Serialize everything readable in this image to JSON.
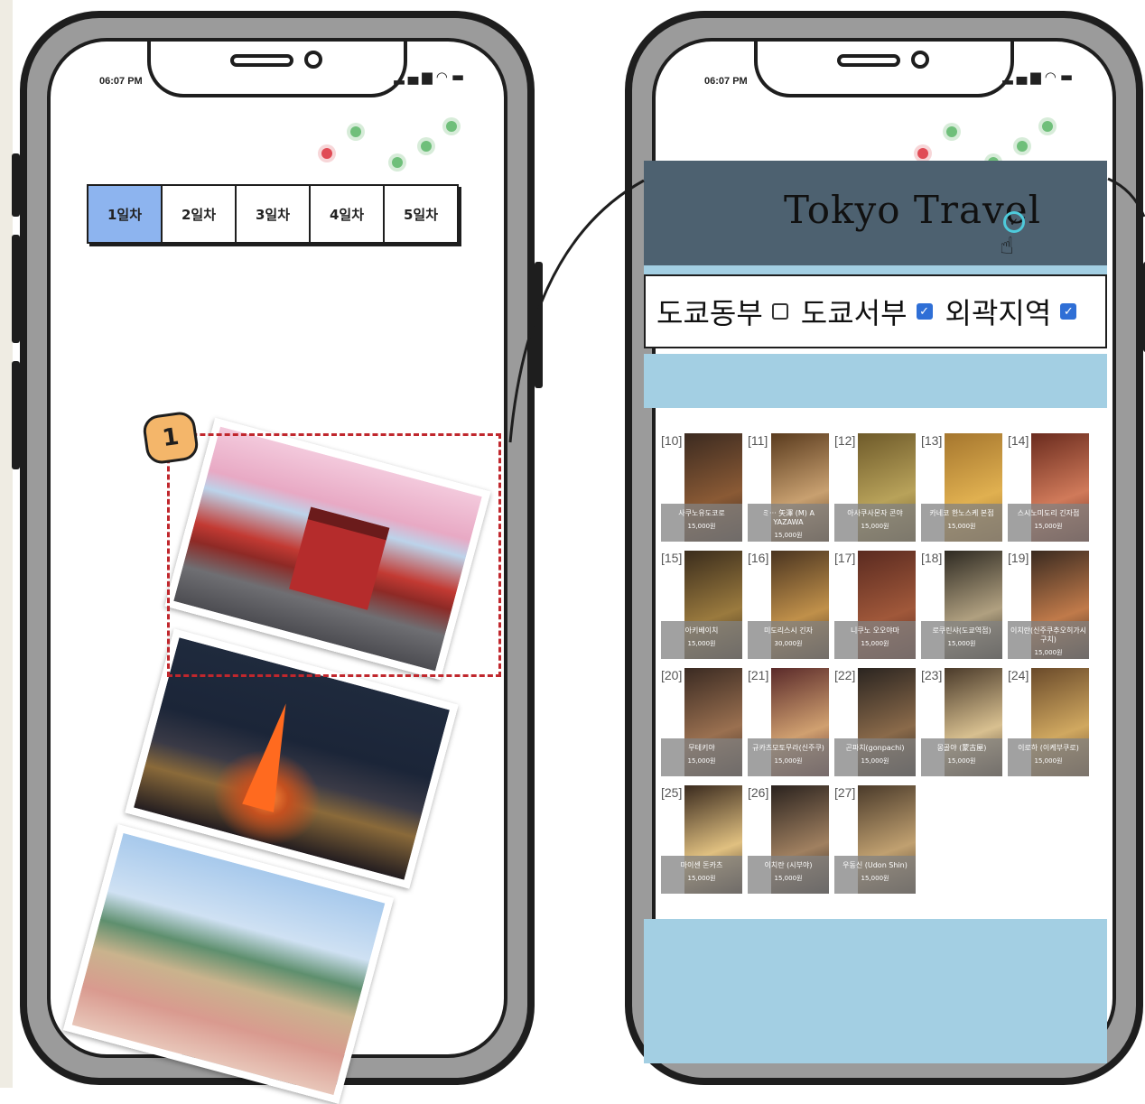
{
  "status_bar": {
    "time": "06:07 PM"
  },
  "left_phone": {
    "day_tabs": [
      {
        "label": "1일차",
        "active": true
      },
      {
        "label": "2일차",
        "active": false
      },
      {
        "label": "3일차",
        "active": false
      },
      {
        "label": "4일차",
        "active": false
      },
      {
        "label": "5일차",
        "active": false
      }
    ],
    "marker_number": "1"
  },
  "right_phone": {
    "app_title": "Tokyo Travel",
    "regions": [
      {
        "label": "도쿄동부",
        "checked": false
      },
      {
        "label": "도쿄서부",
        "checked": true
      },
      {
        "label": "외곽지역",
        "checked": true
      }
    ],
    "restaurants": [
      {
        "num": "[10]",
        "name": "사쿠노유도코로",
        "price": "15,000원"
      },
      {
        "num": "[11]",
        "name": "ミ··· 矢澤 (M) A YAZAWA",
        "price": "15,000원"
      },
      {
        "num": "[12]",
        "name": "아사쿠사몬자 콘야",
        "price": "15,000원"
      },
      {
        "num": "[13]",
        "name": "카네코 한노스케 본점",
        "price": "15,000원"
      },
      {
        "num": "[14]",
        "name": "스시노미도리 긴자점",
        "price": "15,000원"
      },
      {
        "num": "[15]",
        "name": "아키베이치",
        "price": "15,000원"
      },
      {
        "num": "[16]",
        "name": "미도리스시 긴자",
        "price": "30,000원"
      },
      {
        "num": "[17]",
        "name": "니쿠노 오오야마",
        "price": "15,000원"
      },
      {
        "num": "[18]",
        "name": "로쿠린샤(도쿄역점)",
        "price": "15,000원"
      },
      {
        "num": "[19]",
        "name": "이치란(신주쿠추오히가시구치)",
        "price": "15,000원"
      },
      {
        "num": "[20]",
        "name": "무테키야",
        "price": "15,000원"
      },
      {
        "num": "[21]",
        "name": "규카츠모토무라(신주쿠)",
        "price": "15,000원"
      },
      {
        "num": "[22]",
        "name": "곤파치(gonpachi)",
        "price": "15,000원"
      },
      {
        "num": "[23]",
        "name": "몽골야 (蒙古屋)",
        "price": "15,000원"
      },
      {
        "num": "[24]",
        "name": "이로하 (이케부쿠로)",
        "price": "15,000원"
      },
      {
        "num": "[25]",
        "name": "마이센 돈카츠",
        "price": "15,000원"
      },
      {
        "num": "[26]",
        "name": "이치란 (시부야)",
        "price": "15,000원"
      },
      {
        "num": "[27]",
        "name": "우동신 (Udon Shin)",
        "price": "15,000원"
      }
    ]
  },
  "colors": {
    "active_tab": "#8db4ef",
    "app_header": "#4d6170",
    "band": "#a3cfe3",
    "marker": "#c0272d",
    "checkbox_on": "#2f6fd6"
  },
  "icons": [
    "signal-icon",
    "wifi-icon",
    "battery-icon",
    "check-circle-icon",
    "hand-cursor-icon"
  ]
}
